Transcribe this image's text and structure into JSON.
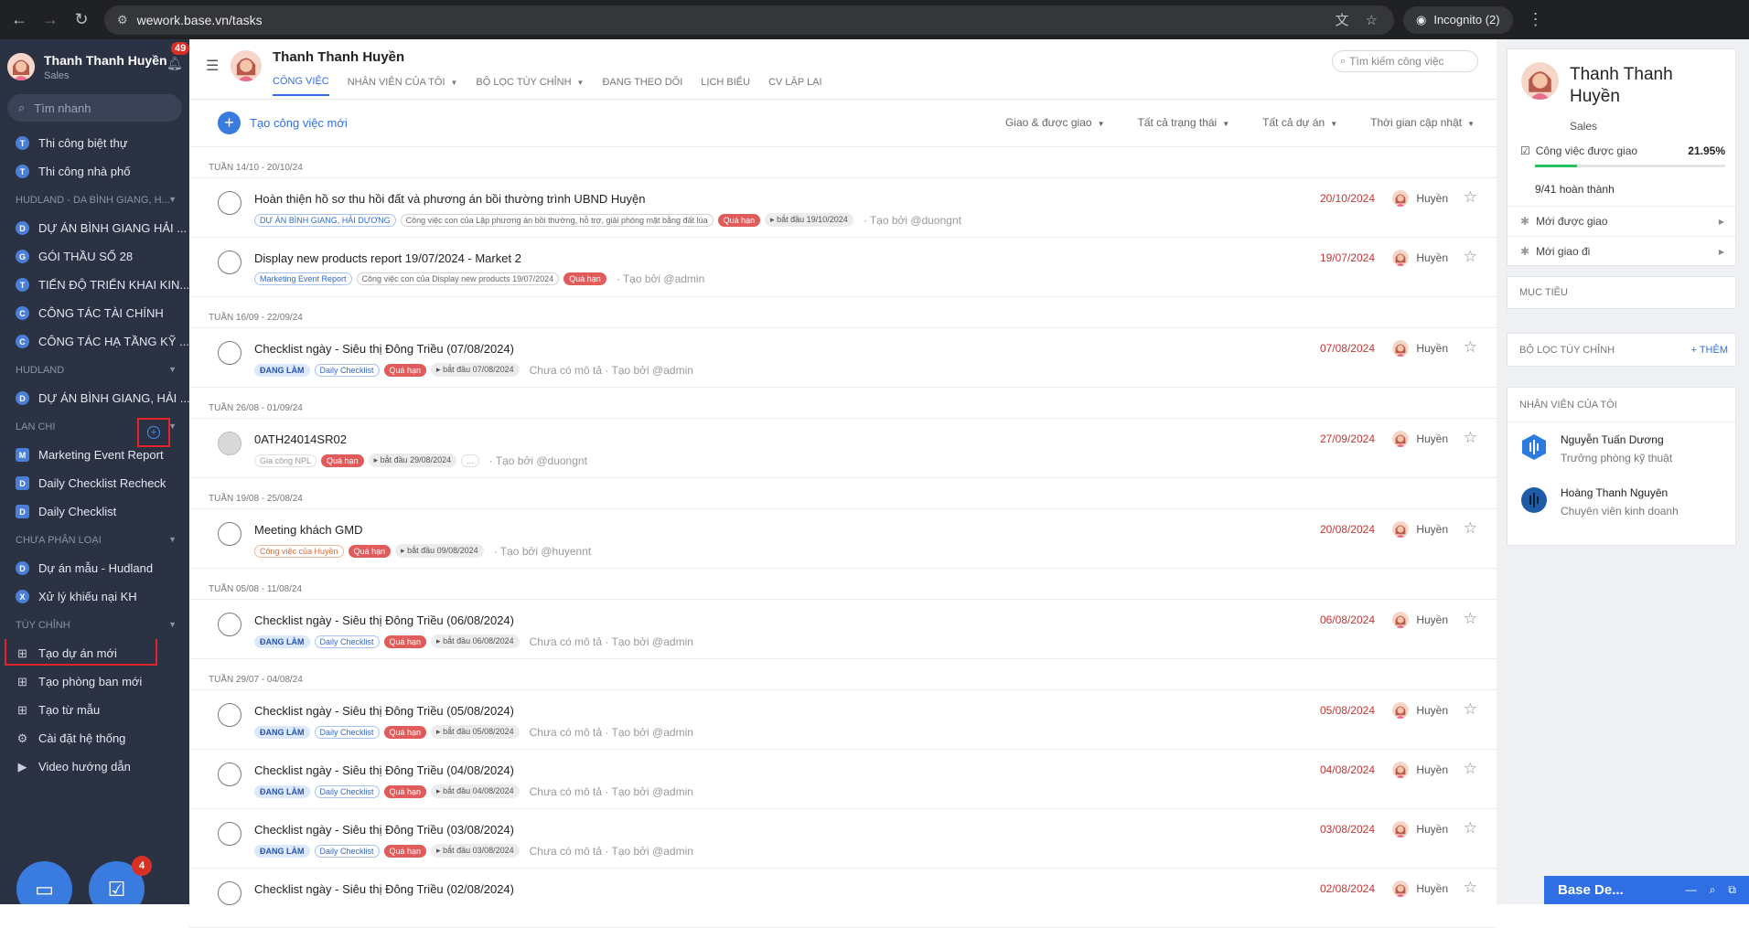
{
  "browser": {
    "url": "wework.base.vn/tasks",
    "profile": "Incognito (2)"
  },
  "sidebar": {
    "user_name": "Thanh Thanh Huyền",
    "user_role": "Sales",
    "notification_count": "49",
    "search_placeholder": "Tìm nhanh",
    "items": [
      {
        "type": "item",
        "letter": "T",
        "label": "Thi công biệt thự"
      },
      {
        "type": "item",
        "letter": "T",
        "label": "Thi công nhà phố"
      },
      {
        "type": "section",
        "label": "HUDLAND - DA BÌNH GIANG, H..."
      },
      {
        "type": "item",
        "letter": "D",
        "label": "DỰ ÁN BÌNH GIANG HẢI ..."
      },
      {
        "type": "item",
        "letter": "G",
        "label": "GÓI THẦU SỐ 28"
      },
      {
        "type": "item",
        "letter": "T",
        "label": "TIẾN ĐỘ TRIỂN KHAI KIN..."
      },
      {
        "type": "item",
        "letter": "C",
        "label": "CÔNG TÁC TÀI CHÍNH"
      },
      {
        "type": "item",
        "letter": "C",
        "label": "CÔNG TÁC HẠ TẦNG KỸ ..."
      },
      {
        "type": "section",
        "label": "HUDLAND"
      },
      {
        "type": "item",
        "letter": "D",
        "label": "DỰ ÁN BÌNH GIANG, HẢI ..."
      },
      {
        "type": "section",
        "label": "LAN CHI"
      },
      {
        "type": "item",
        "letter": "M",
        "label": "Marketing Event Report"
      },
      {
        "type": "item",
        "letter": "D",
        "label": "Daily Checklist Recheck"
      },
      {
        "type": "item",
        "letter": "D",
        "label": "Daily Checklist"
      },
      {
        "type": "section",
        "label": "CHƯA PHÂN LOẠI"
      },
      {
        "type": "item",
        "letter": "D",
        "label": "Dự án mẫu - Hudland"
      },
      {
        "type": "item",
        "letter": "X",
        "label": "Xử lý khiếu nại KH"
      },
      {
        "type": "section",
        "label": "TÙY CHỈNH"
      },
      {
        "type": "action",
        "icon": "plus-square-icon",
        "label": "Tạo dự án mới"
      },
      {
        "type": "action",
        "icon": "plus-square-icon",
        "label": "Tạo phòng ban mới"
      },
      {
        "type": "action",
        "icon": "plus-square-icon",
        "label": "Tạo từ mẫu"
      },
      {
        "type": "action",
        "icon": "gear-icon",
        "label": "Cài đặt hệ thống"
      },
      {
        "type": "action",
        "icon": "play-icon",
        "label": "Video hướng dẫn"
      }
    ],
    "fab_badge": "4"
  },
  "header": {
    "title": "Thanh Thanh Huyền",
    "tabs": [
      {
        "label": "CÔNG VIỆC",
        "active": true,
        "caret": false
      },
      {
        "label": "NHÂN VIÊN CỦA TÔI",
        "active": false,
        "caret": true
      },
      {
        "label": "BỘ LỌC TÙY CHỈNH",
        "active": false,
        "caret": true
      },
      {
        "label": "ĐANG THEO DÕI",
        "active": false,
        "caret": false
      },
      {
        "label": "LỊCH BIỂU",
        "active": false,
        "caret": false
      },
      {
        "label": "CV LẶP LẠI",
        "active": false,
        "caret": false
      }
    ],
    "search_placeholder": "Tìm kiếm công việc"
  },
  "toolbar": {
    "new_task": "Tạo công việc mới",
    "filters": [
      "Giao & được giao",
      "Tất cả trạng thái",
      "Tất cả dự án",
      "Thời gian cập nhật"
    ]
  },
  "task_groups": [
    {
      "week": "TUẦN 14/10 - 20/10/24",
      "tasks": [
        {
          "title": "Hoàn thiện hồ sơ thu hồi đất và phương án bồi thường trình UBND Huyện",
          "check": "open",
          "tags": [
            {
              "text": "DỰ ÁN BÌNH GIANG, HẢI DƯƠNG",
              "style": "blue"
            },
            {
              "text": "Công việc con của Lập phương án bồi thường, hỗ trợ, giải phóng mặt bằng đất lúa",
              "style": "plain"
            },
            {
              "text": "Quá hạn",
              "style": "red"
            },
            {
              "text": "▸ bắt đầu 19/10/2024",
              "style": "gray"
            }
          ],
          "meta": "· Tạo bởi @duongnt",
          "date": "20/10/2024",
          "assignee": "Huyền"
        },
        {
          "title": "Display new products report 19/07/2024 - Market 2",
          "check": "open",
          "tags": [
            {
              "text": "Marketing Event Report",
              "style": "blue"
            },
            {
              "text": "Công việc con của Display new products 19/07/2024",
              "style": "plain"
            },
            {
              "text": "Quá hạn",
              "style": "red"
            }
          ],
          "meta": "· Tạo bởi @admin",
          "date": "19/07/2024",
          "assignee": "Huyền"
        }
      ]
    },
    {
      "week": "TUẦN 16/09 - 22/09/24",
      "tasks": [
        {
          "title": "Checklist ngày - Siêu thị Đông Triều (07/08/2024)",
          "check": "open",
          "tags": [
            {
              "text": "ĐANG LÀM",
              "style": "dang"
            },
            {
              "text": "Daily Checklist",
              "style": "blue"
            },
            {
              "text": "Quá hạn",
              "style": "red"
            },
            {
              "text": "▸ bắt đầu 07/08/2024",
              "style": "gray"
            }
          ],
          "meta": "Chưa có mô tả · Tạo bởi @admin",
          "date": "07/08/2024",
          "assignee": "Huyền"
        }
      ]
    },
    {
      "week": "TUẦN 26/08 - 01/09/24",
      "tasks": [
        {
          "title": "0ATH24014SR02",
          "check": "grey",
          "tags": [
            {
              "text": "Gia công NPL",
              "style": "light"
            },
            {
              "text": "Quá hạn",
              "style": "red"
            },
            {
              "text": "▸ bắt đầu 29/08/2024",
              "style": "gray"
            },
            {
              "text": "...",
              "style": "light"
            }
          ],
          "meta": "· Tạo bởi @duongnt",
          "date": "27/09/2024",
          "assignee": "Huyền"
        }
      ]
    },
    {
      "week": "TUẦN 19/08 - 25/08/24",
      "tasks": [
        {
          "title": "Meeting khách GMD",
          "check": "open",
          "tags": [
            {
              "text": "Công việc của Huyền",
              "style": "orange"
            },
            {
              "text": "Quá hạn",
              "style": "red"
            },
            {
              "text": "▸ bắt đầu 09/08/2024",
              "style": "gray"
            }
          ],
          "meta": "· Tạo bởi @huyennt",
          "date": "20/08/2024",
          "assignee": "Huyền"
        }
      ]
    },
    {
      "week": "TUẦN 05/08 - 11/08/24",
      "tasks": [
        {
          "title": "Checklist ngày - Siêu thị Đông Triều (06/08/2024)",
          "check": "open",
          "tags": [
            {
              "text": "ĐANG LÀM",
              "style": "dang"
            },
            {
              "text": "Daily Checklist",
              "style": "blue"
            },
            {
              "text": "Quá hạn",
              "style": "red"
            },
            {
              "text": "▸ bắt đầu 06/08/2024",
              "style": "gray"
            }
          ],
          "meta": "Chưa có mô tả · Tạo bởi @admin",
          "date": "06/08/2024",
          "assignee": "Huyền"
        }
      ]
    },
    {
      "week": "TUẦN 29/07 - 04/08/24",
      "tasks": [
        {
          "title": "Checklist ngày - Siêu thị Đông Triều (05/08/2024)",
          "check": "open",
          "tags": [
            {
              "text": "ĐANG LÀM",
              "style": "dang"
            },
            {
              "text": "Daily Checklist",
              "style": "blue"
            },
            {
              "text": "Quá hạn",
              "style": "red"
            },
            {
              "text": "▸ bắt đầu 05/08/2024",
              "style": "gray"
            }
          ],
          "meta": "Chưa có mô tả · Tạo bởi @admin",
          "date": "05/08/2024",
          "assignee": "Huyền"
        },
        {
          "title": "Checklist ngày - Siêu thị Đông Triều (04/08/2024)",
          "check": "open",
          "tags": [
            {
              "text": "ĐANG LÀM",
              "style": "dang"
            },
            {
              "text": "Daily Checklist",
              "style": "blue"
            },
            {
              "text": "Quá hạn",
              "style": "red"
            },
            {
              "text": "▸ bắt đầu 04/08/2024",
              "style": "gray"
            }
          ],
          "meta": "Chưa có mô tả · Tạo bởi @admin",
          "date": "04/08/2024",
          "assignee": "Huyền"
        },
        {
          "title": "Checklist ngày - Siêu thị Đông Triều (03/08/2024)",
          "check": "open",
          "tags": [
            {
              "text": "ĐANG LÀM",
              "style": "dang"
            },
            {
              "text": "Daily Checklist",
              "style": "blue"
            },
            {
              "text": "Quá hạn",
              "style": "red"
            },
            {
              "text": "▸ bắt đầu 03/08/2024",
              "style": "gray"
            }
          ],
          "meta": "Chưa có mô tả · Tạo bởi @admin",
          "date": "03/08/2024",
          "assignee": "Huyền"
        },
        {
          "title": "Checklist ngày - Siêu thị Đông Triều (02/08/2024)",
          "check": "open",
          "tags": [],
          "meta": "",
          "date": "02/08/2024",
          "assignee": "Huyền"
        }
      ]
    }
  ],
  "right_panel": {
    "user_name": "Thanh Thanh Huyền",
    "user_role": "Sales",
    "progress_label": "Công việc được giao",
    "progress_percent_text": "21.95%",
    "progress_fraction": 0.2195,
    "done_text": "9/41 hoàn thành",
    "links": [
      "Mới được giao",
      "Mới giao đi"
    ],
    "goals_title": "MỤC TIÊU",
    "filters_title": "BỘ LỌC TÙY CHỈNH",
    "filters_add": "+ THÊM",
    "employees_title": "NHÂN VIÊN CỦA TÔI",
    "employees": [
      {
        "name": "Nguyễn Tuấn Dương",
        "role": "Trưởng phòng kỹ thuật"
      },
      {
        "name": "Hoàng Thanh Nguyên",
        "role": "Chuyên viên kinh doanh"
      }
    ]
  },
  "chat_widget": {
    "label": "Base De..."
  },
  "colors": {
    "accent": "#2f6fe3",
    "sidebar": "#2a3244",
    "overdue": "#e15b5b",
    "date": "#c23535"
  }
}
